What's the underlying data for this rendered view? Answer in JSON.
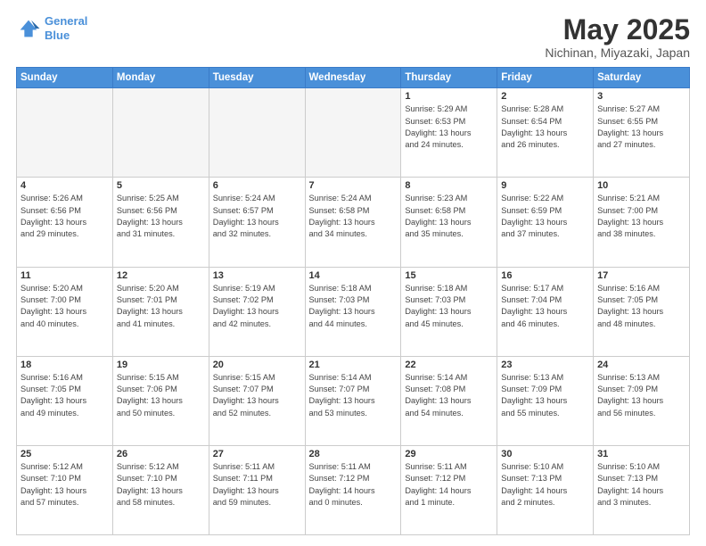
{
  "header": {
    "logo_line1": "General",
    "logo_line2": "Blue",
    "title": "May 2025",
    "subtitle": "Nichinan, Miyazaki, Japan"
  },
  "weekdays": [
    "Sunday",
    "Monday",
    "Tuesday",
    "Wednesday",
    "Thursday",
    "Friday",
    "Saturday"
  ],
  "weeks": [
    [
      {
        "day": "",
        "info": ""
      },
      {
        "day": "",
        "info": ""
      },
      {
        "day": "",
        "info": ""
      },
      {
        "day": "",
        "info": ""
      },
      {
        "day": "1",
        "info": "Sunrise: 5:29 AM\nSunset: 6:53 PM\nDaylight: 13 hours\nand 24 minutes."
      },
      {
        "day": "2",
        "info": "Sunrise: 5:28 AM\nSunset: 6:54 PM\nDaylight: 13 hours\nand 26 minutes."
      },
      {
        "day": "3",
        "info": "Sunrise: 5:27 AM\nSunset: 6:55 PM\nDaylight: 13 hours\nand 27 minutes."
      }
    ],
    [
      {
        "day": "4",
        "info": "Sunrise: 5:26 AM\nSunset: 6:56 PM\nDaylight: 13 hours\nand 29 minutes."
      },
      {
        "day": "5",
        "info": "Sunrise: 5:25 AM\nSunset: 6:56 PM\nDaylight: 13 hours\nand 31 minutes."
      },
      {
        "day": "6",
        "info": "Sunrise: 5:24 AM\nSunset: 6:57 PM\nDaylight: 13 hours\nand 32 minutes."
      },
      {
        "day": "7",
        "info": "Sunrise: 5:24 AM\nSunset: 6:58 PM\nDaylight: 13 hours\nand 34 minutes."
      },
      {
        "day": "8",
        "info": "Sunrise: 5:23 AM\nSunset: 6:58 PM\nDaylight: 13 hours\nand 35 minutes."
      },
      {
        "day": "9",
        "info": "Sunrise: 5:22 AM\nSunset: 6:59 PM\nDaylight: 13 hours\nand 37 minutes."
      },
      {
        "day": "10",
        "info": "Sunrise: 5:21 AM\nSunset: 7:00 PM\nDaylight: 13 hours\nand 38 minutes."
      }
    ],
    [
      {
        "day": "11",
        "info": "Sunrise: 5:20 AM\nSunset: 7:00 PM\nDaylight: 13 hours\nand 40 minutes."
      },
      {
        "day": "12",
        "info": "Sunrise: 5:20 AM\nSunset: 7:01 PM\nDaylight: 13 hours\nand 41 minutes."
      },
      {
        "day": "13",
        "info": "Sunrise: 5:19 AM\nSunset: 7:02 PM\nDaylight: 13 hours\nand 42 minutes."
      },
      {
        "day": "14",
        "info": "Sunrise: 5:18 AM\nSunset: 7:03 PM\nDaylight: 13 hours\nand 44 minutes."
      },
      {
        "day": "15",
        "info": "Sunrise: 5:18 AM\nSunset: 7:03 PM\nDaylight: 13 hours\nand 45 minutes."
      },
      {
        "day": "16",
        "info": "Sunrise: 5:17 AM\nSunset: 7:04 PM\nDaylight: 13 hours\nand 46 minutes."
      },
      {
        "day": "17",
        "info": "Sunrise: 5:16 AM\nSunset: 7:05 PM\nDaylight: 13 hours\nand 48 minutes."
      }
    ],
    [
      {
        "day": "18",
        "info": "Sunrise: 5:16 AM\nSunset: 7:05 PM\nDaylight: 13 hours\nand 49 minutes."
      },
      {
        "day": "19",
        "info": "Sunrise: 5:15 AM\nSunset: 7:06 PM\nDaylight: 13 hours\nand 50 minutes."
      },
      {
        "day": "20",
        "info": "Sunrise: 5:15 AM\nSunset: 7:07 PM\nDaylight: 13 hours\nand 52 minutes."
      },
      {
        "day": "21",
        "info": "Sunrise: 5:14 AM\nSunset: 7:07 PM\nDaylight: 13 hours\nand 53 minutes."
      },
      {
        "day": "22",
        "info": "Sunrise: 5:14 AM\nSunset: 7:08 PM\nDaylight: 13 hours\nand 54 minutes."
      },
      {
        "day": "23",
        "info": "Sunrise: 5:13 AM\nSunset: 7:09 PM\nDaylight: 13 hours\nand 55 minutes."
      },
      {
        "day": "24",
        "info": "Sunrise: 5:13 AM\nSunset: 7:09 PM\nDaylight: 13 hours\nand 56 minutes."
      }
    ],
    [
      {
        "day": "25",
        "info": "Sunrise: 5:12 AM\nSunset: 7:10 PM\nDaylight: 13 hours\nand 57 minutes."
      },
      {
        "day": "26",
        "info": "Sunrise: 5:12 AM\nSunset: 7:10 PM\nDaylight: 13 hours\nand 58 minutes."
      },
      {
        "day": "27",
        "info": "Sunrise: 5:11 AM\nSunset: 7:11 PM\nDaylight: 13 hours\nand 59 minutes."
      },
      {
        "day": "28",
        "info": "Sunrise: 5:11 AM\nSunset: 7:12 PM\nDaylight: 14 hours\nand 0 minutes."
      },
      {
        "day": "29",
        "info": "Sunrise: 5:11 AM\nSunset: 7:12 PM\nDaylight: 14 hours\nand 1 minute."
      },
      {
        "day": "30",
        "info": "Sunrise: 5:10 AM\nSunset: 7:13 PM\nDaylight: 14 hours\nand 2 minutes."
      },
      {
        "day": "31",
        "info": "Sunrise: 5:10 AM\nSunset: 7:13 PM\nDaylight: 14 hours\nand 3 minutes."
      }
    ]
  ]
}
